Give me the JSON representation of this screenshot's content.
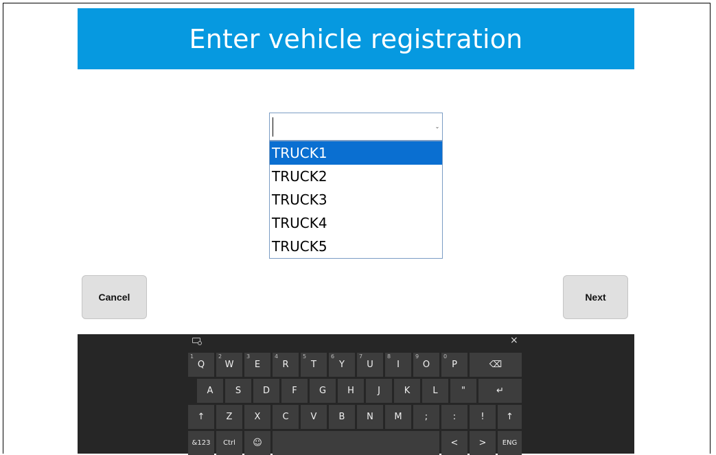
{
  "header": {
    "title": "Enter vehicle registration"
  },
  "combobox": {
    "value": "",
    "arrow": "⌄",
    "options": [
      "TRUCK1",
      "TRUCK2",
      "TRUCK3",
      "TRUCK4",
      "TRUCK5"
    ],
    "selected_index": 0
  },
  "buttons": {
    "cancel": "Cancel",
    "next": "Next"
  },
  "keyboard": {
    "close": "×",
    "row1": [
      {
        "label": "Q",
        "sub": "1"
      },
      {
        "label": "W",
        "sub": "2"
      },
      {
        "label": "E",
        "sub": "3"
      },
      {
        "label": "R",
        "sub": "4"
      },
      {
        "label": "T",
        "sub": "5"
      },
      {
        "label": "Y",
        "sub": "6"
      },
      {
        "label": "U",
        "sub": "7"
      },
      {
        "label": "I",
        "sub": "8"
      },
      {
        "label": "O",
        "sub": "9"
      },
      {
        "label": "P",
        "sub": "0"
      },
      {
        "label": "⌫",
        "sub": ""
      }
    ],
    "row2": [
      "A",
      "S",
      "D",
      "F",
      "G",
      "H",
      "J",
      "K",
      "L",
      "\"",
      "↵"
    ],
    "row3": [
      "↑",
      "Z",
      "X",
      "C",
      "V",
      "B",
      "N",
      "M",
      ";",
      ":",
      "!",
      "↑"
    ],
    "row4": {
      "symbols": "&123",
      "ctrl": "Ctrl",
      "emoji": "☺",
      "left": "<",
      "right": ">",
      "lang": "ENG"
    }
  },
  "colors": {
    "header_bg": "#0699e0",
    "selection": "#0a6fd1",
    "keyboard_bg": "#262626",
    "key_bg": "#3d3d3d"
  }
}
